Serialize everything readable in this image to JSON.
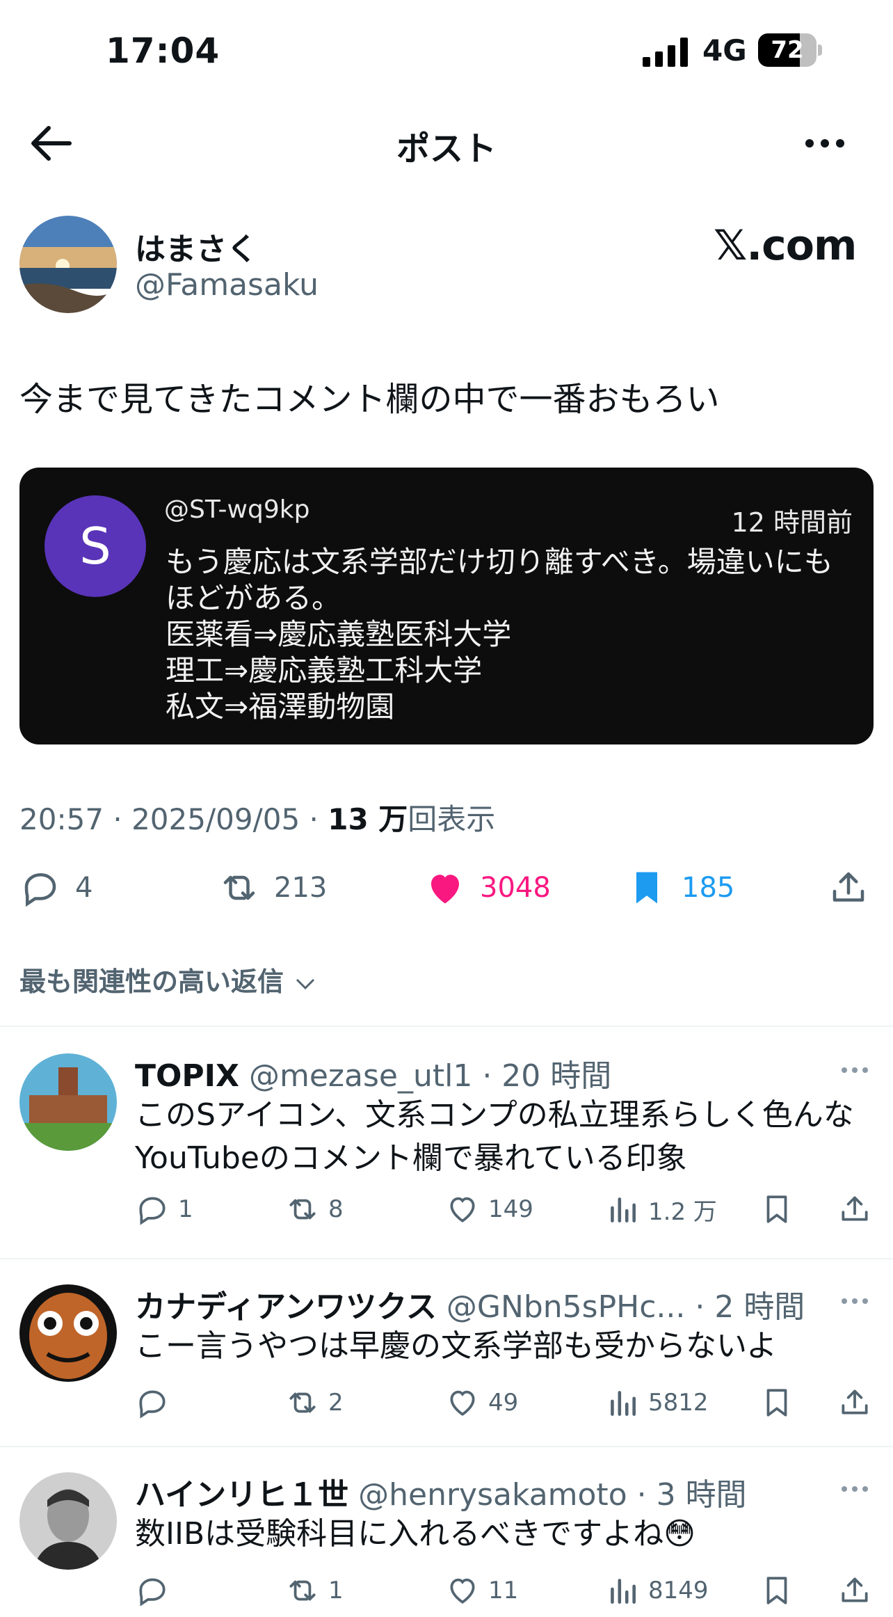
{
  "status_bar": {
    "time": "17:04",
    "network": "4G",
    "battery": "72",
    "battery_level": 0.72
  },
  "nav": {
    "title": "ポスト"
  },
  "post": {
    "author_name": "はまさく",
    "author_handle": "@Famasaku",
    "brand": "𝕏.com",
    "text": "今まで見てきたコメント欄の中で一番おもろい",
    "quoted": {
      "avatar_letter": "S",
      "handle": "@ST-wq9kp",
      "time": "12 時間前",
      "body": "もう慶応は文系学部だけ切り離すべき。場違いにも\nほどがある。\n医薬看⇒慶応義塾医科大学\n理工⇒慶応義塾工科大学\n私文⇒福澤動物園"
    },
    "meta_time": "20:57 · 2025/09/05 · ",
    "meta_views": "13 万",
    "meta_views_suffix": "回表示",
    "stats": {
      "replies": "4",
      "retweets": "213",
      "likes": "3048",
      "bookmarks": "185"
    },
    "colors": {
      "like": "#f91880",
      "bookmark": "#1d9bf0",
      "muted": "#536471"
    }
  },
  "sort": {
    "label": "最も関連性の高い返信"
  },
  "replies": [
    {
      "name": "TOPIX",
      "handle": "@mezase_utl1",
      "time": "· 20 時間",
      "text": "このSアイコン、文系コンプの私立理系らしく色んなYouTubeのコメント欄で暴れている印象",
      "replies": "1",
      "retweets": "8",
      "likes": "149",
      "views": "1.2 万"
    },
    {
      "name": "カナディアンワツクス",
      "handle": "@GNbn5sPHc...",
      "time": "· 2 時間",
      "text": "こー言うやつは早慶の文系学部も受からないよ",
      "replies": "",
      "retweets": "2",
      "likes": "49",
      "views": "5812"
    },
    {
      "name": "ハインリヒ１世",
      "handle": "@henrysakamoto",
      "time": "· 3 時間",
      "text": "数IIBは受験科目に入れるべきですよね😳",
      "replies": "",
      "retweets": "1",
      "likes": "11",
      "views": "8149"
    }
  ]
}
